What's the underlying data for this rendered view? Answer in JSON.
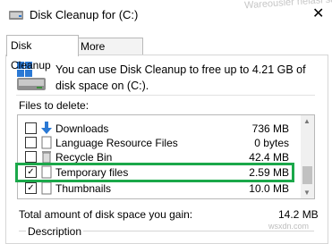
{
  "window": {
    "title": "Disk Cleanup for  (C:)",
    "close_glyph": "✕",
    "watermark_top": "Wareousler nelasi saakhe"
  },
  "tabs": [
    {
      "label": "Disk Cleanup",
      "active": true
    },
    {
      "label": "More Options",
      "active": false
    }
  ],
  "info_text": "You can use Disk Cleanup to free up to 4.21 GB of disk space on  (C:).",
  "files_to_delete_label": "Files to delete:",
  "files": [
    {
      "name": "Downloads",
      "size": "736 MB",
      "checked": false,
      "icon": "download-arrow-icon"
    },
    {
      "name": "Language Resource Files",
      "size": "0 bytes",
      "checked": false,
      "icon": "document-icon"
    },
    {
      "name": "Recycle Bin",
      "size": "42.4 MB",
      "checked": false,
      "icon": "recycle-bin-icon"
    },
    {
      "name": "Temporary files",
      "size": "2.59 MB",
      "checked": true,
      "icon": "document-icon"
    },
    {
      "name": "Thumbnails",
      "size": "10.0 MB",
      "checked": true,
      "icon": "document-icon"
    }
  ],
  "check_glyph": "✓",
  "scroll_up_glyph": "▲",
  "scroll_down_glyph": "▼",
  "total_label": "Total amount of disk space you gain:",
  "total_value": "14.2 MB",
  "description_label": "Description",
  "watermark_site": "wsxdn.com",
  "colors": {
    "highlight": "#1ba84a",
    "accent": "#2b79d4"
  }
}
